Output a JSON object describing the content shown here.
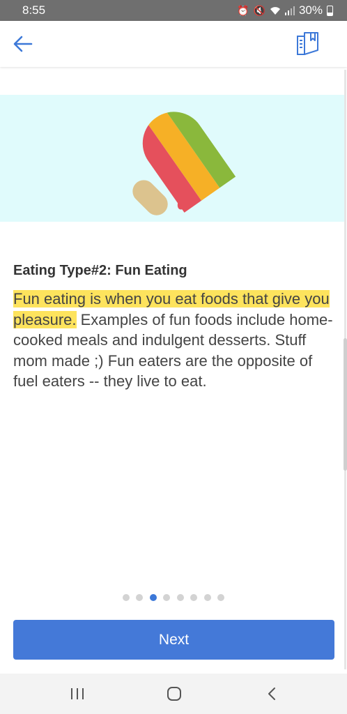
{
  "status_bar": {
    "time": "8:55",
    "battery": "30%"
  },
  "icons": {
    "back": "arrow-left-icon",
    "journal": "journal-icon",
    "recents": "recents-icon",
    "home": "home-icon",
    "nav_back": "chevron-left-icon"
  },
  "content": {
    "title": "Eating Type#2: Fun Eating",
    "highlighted_text": "Fun eating is when you eat foods that give you pleasure.",
    "body_text": " Examples of fun foods include home-cooked meals and indulgent desserts. Stuff mom made ;) Fun eaters are the opposite of fuel eaters -- they live to eat."
  },
  "pager": {
    "total": 8,
    "current": 3
  },
  "buttons": {
    "next_label": "Next"
  },
  "colors": {
    "accent": "#4479d8",
    "hero_background": "#e0fbfc",
    "highlight": "#fde35d"
  }
}
